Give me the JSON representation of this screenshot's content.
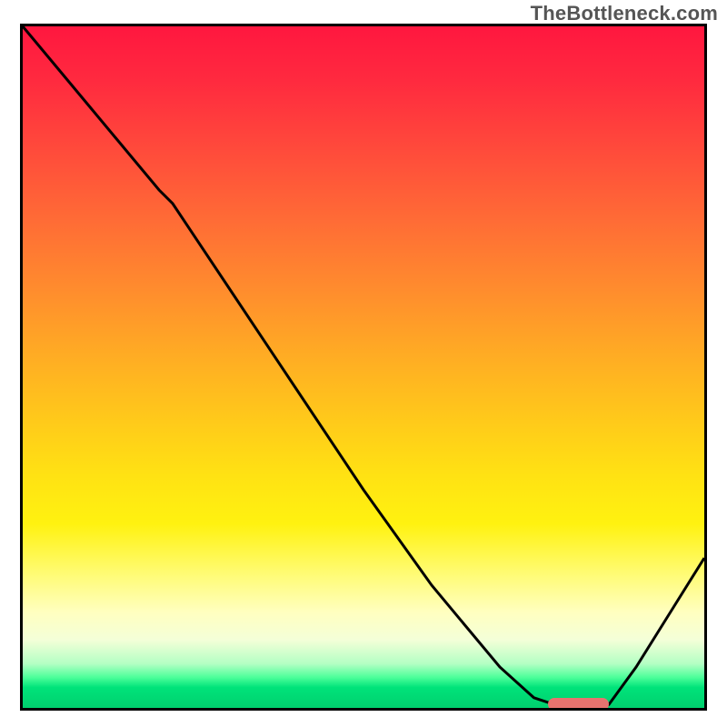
{
  "watermark": "TheBottleneck.com",
  "colors": {
    "border": "#000000",
    "curve": "#000000",
    "marker": "#e8736f",
    "gradient_top": "#ff173f",
    "gradient_bottom": "#00d06e"
  },
  "chart_data": {
    "type": "line",
    "title": "",
    "xlabel": "",
    "ylabel": "",
    "xlim": [
      0,
      100
    ],
    "ylim": [
      0,
      100
    ],
    "grid": false,
    "legend": false,
    "series": [
      {
        "name": "bottleneck-curve",
        "x": [
          0,
          5,
          10,
          15,
          20,
          22,
          30,
          40,
          50,
          60,
          70,
          75,
          78,
          82,
          86,
          90,
          95,
          100
        ],
        "y": [
          100,
          94,
          88,
          82,
          76,
          74,
          62,
          47,
          32,
          18,
          6,
          1.5,
          0.5,
          0.5,
          0.5,
          6,
          14,
          22
        ]
      }
    ],
    "annotations": [
      {
        "name": "optimal-range-marker",
        "x_start": 77,
        "x_end": 86,
        "y": 0.5
      }
    ],
    "background_gradient": {
      "orientation": "vertical",
      "stops": [
        {
          "pos": 0.0,
          "color": "#ff173f"
        },
        {
          "pos": 0.28,
          "color": "#ff6a36"
        },
        {
          "pos": 0.58,
          "color": "#ffca1a"
        },
        {
          "pos": 0.8,
          "color": "#fffb70"
        },
        {
          "pos": 0.94,
          "color": "#4dff9a"
        },
        {
          "pos": 1.0,
          "color": "#00d06e"
        }
      ]
    }
  }
}
